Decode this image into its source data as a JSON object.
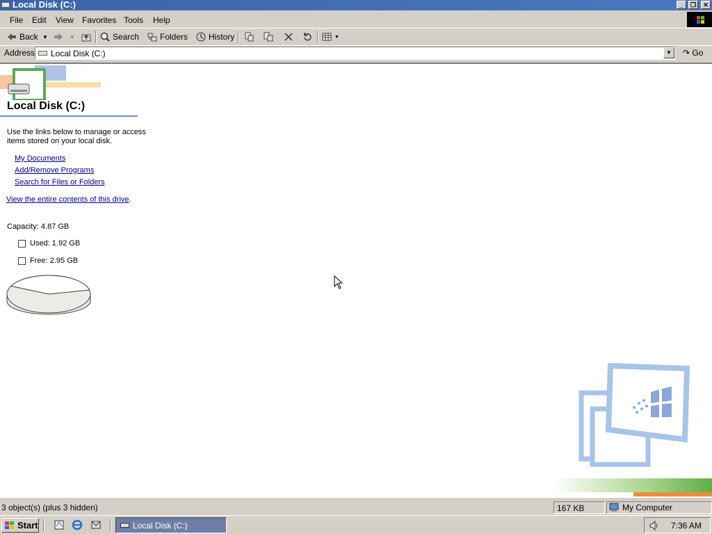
{
  "window": {
    "title": "Local Disk (C:)"
  },
  "menu": [
    "File",
    "Edit",
    "View",
    "Favorites",
    "Tools",
    "Help"
  ],
  "toolbar": {
    "back": "Back",
    "search": "Search",
    "folders": "Folders",
    "history": "History"
  },
  "address": {
    "label": "Address",
    "value": "Local Disk (C:)",
    "go": "Go"
  },
  "content": {
    "title": "Local Disk (C:)",
    "description": "Use the links below to manage or access items stored on your local disk.",
    "links": [
      "My Documents",
      "Add/Remove Programs",
      "Search for Files or Folders"
    ],
    "view_all": "View the entire contents of this drive",
    "view_all_suffix": ".",
    "capacity": "Capacity: 4.87 GB",
    "used": "Used: 1.92 GB",
    "free": "Free: 2.95 GB",
    "used_fraction": 0.394
  },
  "status": {
    "objects": "3 object(s) (plus 3 hidden)",
    "size": "167 KB",
    "zone": "My Computer"
  },
  "taskbar": {
    "start": "Start",
    "task": "Local Disk (C:)",
    "clock": "7:36 AM"
  },
  "colors": {
    "title_bar": "#3b64a8",
    "link": "#00008b",
    "active_task": "#6f7ea6"
  },
  "icons": [
    "drive-icon",
    "back-arrow-icon",
    "forward-arrow-icon",
    "up-folder-icon",
    "search-icon",
    "folders-icon",
    "history-icon",
    "move-to-icon",
    "copy-to-icon",
    "delete-icon",
    "undo-icon",
    "views-icon",
    "go-arrow-icon",
    "computer-icon",
    "windows-logo-icon",
    "volume-icon",
    "show-desktop-icon",
    "ie-icon",
    "outlook-icon"
  ]
}
